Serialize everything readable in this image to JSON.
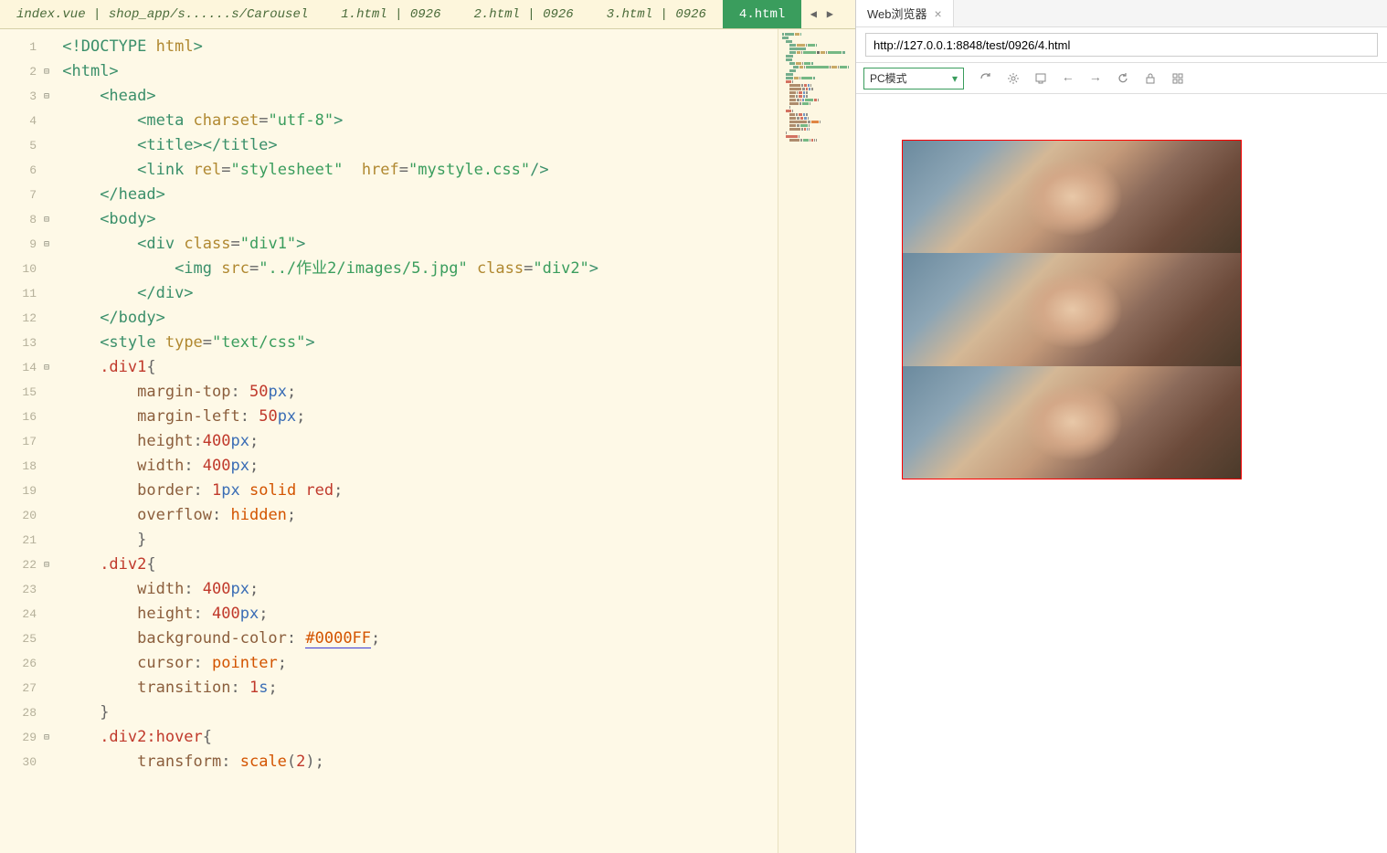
{
  "tabs": [
    {
      "label": "index.vue | shop_app/s......s/Carousel",
      "active": false
    },
    {
      "label": "1.html | 0926",
      "active": false
    },
    {
      "label": "2.html | 0926",
      "active": false
    },
    {
      "label": "3.html | 0926",
      "active": false
    },
    {
      "label": "4.html",
      "active": true
    }
  ],
  "code_lines": [
    {
      "n": 1,
      "fold": "",
      "tokens": [
        {
          "t": "<!",
          "c": "tag"
        },
        {
          "t": "DOCTYPE ",
          "c": "tag"
        },
        {
          "t": "html",
          "c": "attr"
        },
        {
          "t": ">",
          "c": "tag"
        }
      ],
      "indent": 0
    },
    {
      "n": 2,
      "fold": "⊟",
      "tokens": [
        {
          "t": "<html>",
          "c": "tag"
        }
      ],
      "indent": 0
    },
    {
      "n": 3,
      "fold": "⊟",
      "tokens": [
        {
          "t": "<head>",
          "c": "tag"
        }
      ],
      "indent": 2
    },
    {
      "n": 4,
      "fold": "",
      "tokens": [
        {
          "t": "<meta ",
          "c": "tag"
        },
        {
          "t": "charset",
          "c": "attr"
        },
        {
          "t": "=",
          "c": "punc"
        },
        {
          "t": "\"utf-8\"",
          "c": "str"
        },
        {
          "t": ">",
          "c": "tag"
        }
      ],
      "indent": 4
    },
    {
      "n": 5,
      "fold": "",
      "tokens": [
        {
          "t": "<title></title>",
          "c": "tag"
        }
      ],
      "indent": 4
    },
    {
      "n": 6,
      "fold": "",
      "tokens": [
        {
          "t": "<link ",
          "c": "tag"
        },
        {
          "t": "rel",
          "c": "attr"
        },
        {
          "t": "=",
          "c": "punc"
        },
        {
          "t": "\"stylesheet\"",
          "c": "str"
        },
        {
          "t": "  ",
          "c": "txt"
        },
        {
          "t": "href",
          "c": "attr"
        },
        {
          "t": "=",
          "c": "punc"
        },
        {
          "t": "\"mystyle.css\"",
          "c": "str"
        },
        {
          "t": "/>",
          "c": "tag"
        }
      ],
      "indent": 4
    },
    {
      "n": 7,
      "fold": "",
      "tokens": [
        {
          "t": "</head>",
          "c": "tag"
        }
      ],
      "indent": 2
    },
    {
      "n": 8,
      "fold": "⊟",
      "tokens": [
        {
          "t": "<body>",
          "c": "tag"
        }
      ],
      "indent": 2
    },
    {
      "n": 9,
      "fold": "⊟",
      "tokens": [
        {
          "t": "<div ",
          "c": "tag"
        },
        {
          "t": "class",
          "c": "attr"
        },
        {
          "t": "=",
          "c": "punc"
        },
        {
          "t": "\"div1\"",
          "c": "str"
        },
        {
          "t": ">",
          "c": "tag"
        }
      ],
      "indent": 4
    },
    {
      "n": 10,
      "fold": "",
      "tokens": [
        {
          "t": "<img ",
          "c": "tag"
        },
        {
          "t": "src",
          "c": "attr"
        },
        {
          "t": "=",
          "c": "punc"
        },
        {
          "t": "\"../作业2/images/5.jpg\"",
          "c": "str"
        },
        {
          "t": " ",
          "c": "txt"
        },
        {
          "t": "class",
          "c": "attr"
        },
        {
          "t": "=",
          "c": "punc"
        },
        {
          "t": "\"div2\"",
          "c": "str"
        },
        {
          "t": ">",
          "c": "tag"
        }
      ],
      "indent": 6
    },
    {
      "n": 11,
      "fold": "",
      "tokens": [
        {
          "t": "</div>",
          "c": "tag"
        }
      ],
      "indent": 4
    },
    {
      "n": 12,
      "fold": "",
      "tokens": [
        {
          "t": "</body>",
          "c": "tag"
        }
      ],
      "indent": 2
    },
    {
      "n": 13,
      "fold": "",
      "tokens": [
        {
          "t": "<style ",
          "c": "tag"
        },
        {
          "t": "type",
          "c": "attr"
        },
        {
          "t": "=",
          "c": "punc"
        },
        {
          "t": "\"text/css\"",
          "c": "str"
        },
        {
          "t": ">",
          "c": "tag"
        }
      ],
      "indent": 2
    },
    {
      "n": 14,
      "fold": "⊟",
      "tokens": [
        {
          "t": ".div1",
          "c": "sel"
        },
        {
          "t": "{",
          "c": "punc"
        }
      ],
      "indent": 2
    },
    {
      "n": 15,
      "fold": "",
      "tokens": [
        {
          "t": "margin-top",
          "c": "prop"
        },
        {
          "t": ": ",
          "c": "punc"
        },
        {
          "t": "50",
          "c": "num"
        },
        {
          "t": "px",
          "c": "kw"
        },
        {
          "t": ";",
          "c": "punc"
        }
      ],
      "indent": 4
    },
    {
      "n": 16,
      "fold": "",
      "tokens": [
        {
          "t": "margin-left",
          "c": "prop"
        },
        {
          "t": ": ",
          "c": "punc"
        },
        {
          "t": "50",
          "c": "num"
        },
        {
          "t": "px",
          "c": "kw"
        },
        {
          "t": ";",
          "c": "punc"
        }
      ],
      "indent": 4
    },
    {
      "n": 17,
      "fold": "",
      "tokens": [
        {
          "t": "height",
          "c": "prop"
        },
        {
          "t": ":",
          "c": "punc"
        },
        {
          "t": "400",
          "c": "num"
        },
        {
          "t": "px",
          "c": "kw"
        },
        {
          "t": ";",
          "c": "punc"
        }
      ],
      "indent": 4
    },
    {
      "n": 18,
      "fold": "",
      "tokens": [
        {
          "t": "width",
          "c": "prop"
        },
        {
          "t": ": ",
          "c": "punc"
        },
        {
          "t": "400",
          "c": "num"
        },
        {
          "t": "px",
          "c": "kw"
        },
        {
          "t": ";",
          "c": "punc"
        }
      ],
      "indent": 4
    },
    {
      "n": 19,
      "fold": "",
      "tokens": [
        {
          "t": "border",
          "c": "prop"
        },
        {
          "t": ": ",
          "c": "punc"
        },
        {
          "t": "1",
          "c": "num"
        },
        {
          "t": "px",
          "c": "kw"
        },
        {
          "t": " solid ",
          "c": "val"
        },
        {
          "t": "red",
          "c": "num"
        },
        {
          "t": ";",
          "c": "punc"
        }
      ],
      "indent": 4
    },
    {
      "n": 20,
      "fold": "",
      "tokens": [
        {
          "t": "overflow",
          "c": "prop"
        },
        {
          "t": ": ",
          "c": "punc"
        },
        {
          "t": "hidden",
          "c": "val"
        },
        {
          "t": ";",
          "c": "punc"
        }
      ],
      "indent": 4
    },
    {
      "n": 21,
      "fold": "",
      "tokens": [
        {
          "t": "}",
          "c": "punc"
        }
      ],
      "indent": 4
    },
    {
      "n": 22,
      "fold": "⊟",
      "tokens": [
        {
          "t": ".div2",
          "c": "sel"
        },
        {
          "t": "{",
          "c": "punc"
        }
      ],
      "indent": 2
    },
    {
      "n": 23,
      "fold": "",
      "tokens": [
        {
          "t": "width",
          "c": "prop"
        },
        {
          "t": ": ",
          "c": "punc"
        },
        {
          "t": "400",
          "c": "num"
        },
        {
          "t": "px",
          "c": "kw"
        },
        {
          "t": ";",
          "c": "punc"
        }
      ],
      "indent": 4
    },
    {
      "n": 24,
      "fold": "",
      "tokens": [
        {
          "t": "height",
          "c": "prop"
        },
        {
          "t": ": ",
          "c": "punc"
        },
        {
          "t": "400",
          "c": "num"
        },
        {
          "t": "px",
          "c": "kw"
        },
        {
          "t": ";",
          "c": "punc"
        }
      ],
      "indent": 4
    },
    {
      "n": 25,
      "fold": "",
      "tokens": [
        {
          "t": "background-color",
          "c": "prop"
        },
        {
          "t": ": ",
          "c": "punc"
        },
        {
          "t": "#0000FF",
          "c": "hex"
        },
        {
          "t": ";",
          "c": "punc"
        }
      ],
      "indent": 4
    },
    {
      "n": 26,
      "fold": "",
      "tokens": [
        {
          "t": "cursor",
          "c": "prop"
        },
        {
          "t": ": ",
          "c": "punc"
        },
        {
          "t": "pointer",
          "c": "val"
        },
        {
          "t": ";",
          "c": "punc"
        }
      ],
      "indent": 4
    },
    {
      "n": 27,
      "fold": "",
      "tokens": [
        {
          "t": "transition",
          "c": "prop"
        },
        {
          "t": ": ",
          "c": "punc"
        },
        {
          "t": "1",
          "c": "num"
        },
        {
          "t": "s",
          "c": "kw"
        },
        {
          "t": ";",
          "c": "punc"
        }
      ],
      "indent": 4
    },
    {
      "n": 28,
      "fold": "",
      "tokens": [
        {
          "t": "}",
          "c": "punc"
        }
      ],
      "indent": 2
    },
    {
      "n": 29,
      "fold": "⊟",
      "tokens": [
        {
          "t": ".div2:hover",
          "c": "sel"
        },
        {
          "t": "{",
          "c": "punc"
        }
      ],
      "indent": 2
    },
    {
      "n": 30,
      "fold": "",
      "tokens": [
        {
          "t": "transform",
          "c": "prop"
        },
        {
          "t": ": ",
          "c": "punc"
        },
        {
          "t": "scale",
          "c": "val"
        },
        {
          "t": "(",
          "c": "punc"
        },
        {
          "t": "2",
          "c": "num"
        },
        {
          "t": ")",
          "c": "punc"
        },
        {
          "t": ";",
          "c": "punc"
        }
      ],
      "indent": 4
    }
  ],
  "browser": {
    "tab_title": "Web浏览器",
    "url": "http://127.0.0.1:8848/test/0926/4.html",
    "mode": "PC模式"
  }
}
